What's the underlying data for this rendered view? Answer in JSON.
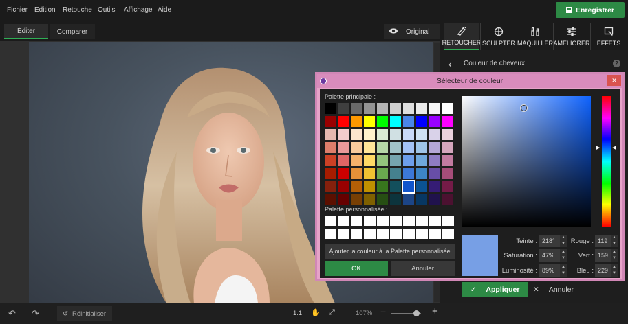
{
  "menu": [
    "Fichier",
    "Edition",
    "Retouche",
    "Outils",
    "Affichage",
    "Aide"
  ],
  "save_label": "Enregistrer",
  "mode_tabs": {
    "edit": "Éditer",
    "compare": "Comparer"
  },
  "original_label": "Original",
  "tools": [
    {
      "label": "RETOUCHER",
      "icon": "retouch-icon"
    },
    {
      "label": "SCULPTER",
      "icon": "sculpt-icon"
    },
    {
      "label": "MAQUILLER",
      "icon": "makeup-icon"
    },
    {
      "label": "AMÉLIORER",
      "icon": "sliders-icon"
    },
    {
      "label": "EFFETS",
      "icon": "effects-icon"
    }
  ],
  "panel": {
    "back_title": "Couleur de cheveux",
    "help": "?"
  },
  "dialog": {
    "title": "Sélecteur de couleur",
    "main_palette_label": "Palette principale :",
    "custom_palette_label": "Palette personnalisée :",
    "add_custom_label": "Ajouter la couleur à la Palette personnalisée",
    "ok_label": "OK",
    "cancel_label": "Annuler",
    "hue_label": "Teinte :",
    "hue_value": "218°",
    "sat_label": "Saturation :",
    "sat_value": "47%",
    "lum_label": "Luminosité :",
    "lum_value": "89%",
    "red_label": "Rouge :",
    "red_value": "119",
    "green_label": "Vert :",
    "green_value": "159",
    "blue_label": "Bleu :",
    "blue_value": "229",
    "selected_color": "#779fe5",
    "palette_rows": [
      [
        "#000000",
        "#3f3f3f",
        "#6a6a6a",
        "#939393",
        "#b4b4b4",
        "#cfcfcf",
        "#dedede",
        "#ebebeb",
        "#f6f6f6",
        "#ffffff"
      ],
      [
        "#990000",
        "#ff0000",
        "#ff9900",
        "#ffff00",
        "#00ff00",
        "#00ffff",
        "#4a86e8",
        "#0000ff",
        "#9900ff",
        "#ff00ff"
      ],
      [
        "#e6b8af",
        "#f4cccc",
        "#fce5cd",
        "#fff2cc",
        "#d9ead3",
        "#d0e0e3",
        "#c9daf8",
        "#cfe2f3",
        "#d9d2e9",
        "#ead1dc"
      ],
      [
        "#dd7e6b",
        "#ea9999",
        "#f9cb9c",
        "#ffe599",
        "#b6d7a8",
        "#a2c4c9",
        "#a4c2f4",
        "#9fc5e8",
        "#b4a7d6",
        "#d5a6bd"
      ],
      [
        "#cc4125",
        "#e06666",
        "#f6b26b",
        "#ffd966",
        "#93c47d",
        "#76a5af",
        "#6d9eeb",
        "#6fa8dc",
        "#8e7cc3",
        "#c27ba0"
      ],
      [
        "#a61c00",
        "#cc0000",
        "#e69138",
        "#f1c232",
        "#6aa84f",
        "#45818e",
        "#3c78d8",
        "#3d85c6",
        "#674ea7",
        "#a64d79"
      ],
      [
        "#85200c",
        "#990000",
        "#b45f06",
        "#bf9000",
        "#38761d",
        "#134f5c",
        "#1155cc",
        "#0b5394",
        "#351c75",
        "#741b47"
      ],
      [
        "#5b0f00",
        "#660000",
        "#783f04",
        "#7f6000",
        "#274e13",
        "#0c343d",
        "#1c4587",
        "#073763",
        "#20124d",
        "#4c1130"
      ]
    ]
  },
  "apply_label": "Appliquer",
  "cancel_panel_label": "Annuler",
  "bottom": {
    "reset_label": "Réinitialiser",
    "ratio_label": "1:1",
    "zoom_value": "107%"
  }
}
